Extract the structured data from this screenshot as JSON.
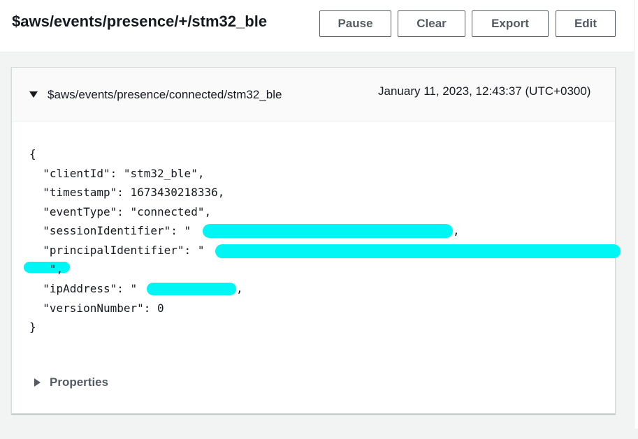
{
  "header": {
    "topic_filter": "$aws/events/presence/+/stm32_ble",
    "buttons": {
      "pause": "Pause",
      "clear": "Clear",
      "export": "Export",
      "edit": "Edit"
    }
  },
  "message": {
    "topic": "$aws/events/presence/connected/stm32_ble",
    "timestamp_display": "January 11, 2023, 12:43:37 (UTC+0300)",
    "payload_lines": {
      "open_brace": "{",
      "client_id": "  \"clientId\": \"stm32_ble\",",
      "timestamp": "  \"timestamp\": 1673430218336,",
      "event_type": "  \"eventType\": \"connected\",",
      "session_identifier": "  \"sessionIdentifier\": \"",
      "session_identifier_end": ",",
      "principal_identifier": "  \"principalIdentifier\": \"",
      "principal_identifier_cont": "   \",",
      "ip_address": "  \"ipAddress\": \"",
      "ip_address_end": ",",
      "version_number": "  \"versionNumber\": 0",
      "close_brace": "}"
    },
    "redaction_color": "#00f5f5",
    "properties_label": "Properties"
  }
}
